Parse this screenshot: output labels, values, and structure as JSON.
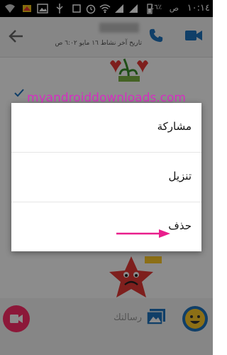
{
  "status_bar": {
    "time": "١٠:١٤",
    "ampm": "ص",
    "battery_percent": "٤٦٪"
  },
  "header": {
    "last_seen": "تاريخ آخر نشاط ١٦ مايو ٦:٠٢ ص"
  },
  "watermark": "myandroiddownloads.com",
  "menu": {
    "items": [
      {
        "label": "مشاركة"
      },
      {
        "label": "تنزيل"
      },
      {
        "label": "حذف"
      }
    ]
  },
  "composer": {
    "placeholder": "رسالتك"
  },
  "colors": {
    "accent_blue": "#1e73be",
    "video_pink": "#ff2d68",
    "arrow_pink": "#e91e8c",
    "watermark": "#d62ec1"
  }
}
